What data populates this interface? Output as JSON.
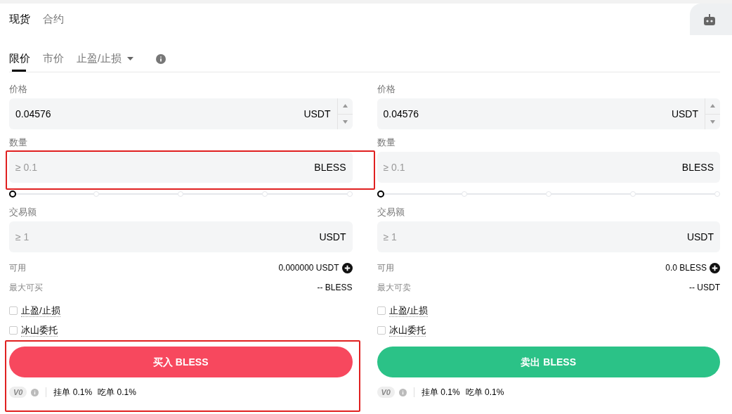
{
  "market_tabs": [
    {
      "label": "现货",
      "selected": true
    },
    {
      "label": "合约",
      "selected": false
    }
  ],
  "order_types": [
    {
      "label": "限价",
      "selected": true,
      "kind": "tab"
    },
    {
      "label": "市价",
      "selected": false,
      "kind": "tab"
    },
    {
      "label": "止盈/止损",
      "selected": false,
      "kind": "dropdown"
    }
  ],
  "panels": [
    {
      "kind": "buy",
      "rows": [
        {
          "kind": "field",
          "label": "价格",
          "value": "0.04576",
          "unit": "USDT",
          "stepper": true
        },
        {
          "kind": "field",
          "label": "数量",
          "placeholder": "≥ 0.1",
          "unit": "BLESS",
          "stepper": false
        },
        {
          "kind": "slider",
          "level": 0
        },
        {
          "kind": "field",
          "label": "交易额",
          "placeholder": "≥ 1",
          "unit": "USDT",
          "stepper": false
        }
      ],
      "available": {
        "label": "可用",
        "value": "0.000000 USDT"
      },
      "max": {
        "label": "最大可买",
        "value": "-- BLESS"
      },
      "checkboxes": [
        {
          "label": "止盈/止损",
          "checked": false
        },
        {
          "label": "冰山委托",
          "checked": false
        }
      ],
      "button": "买入 BLESS",
      "tier": "V0",
      "maker": "挂单 0.1%",
      "taker": "吃单 0.1%"
    },
    {
      "kind": "sell",
      "rows": [
        {
          "kind": "field",
          "label": "价格",
          "value": "0.04576",
          "unit": "USDT",
          "stepper": true
        },
        {
          "kind": "field",
          "label": "数量",
          "placeholder": "≥ 0.1",
          "unit": "BLESS",
          "stepper": false
        },
        {
          "kind": "slider",
          "level": 0
        },
        {
          "kind": "field",
          "label": "交易额",
          "placeholder": "≥ 1",
          "unit": "USDT",
          "stepper": false
        }
      ],
      "available": {
        "label": "可用",
        "value": "0.0 BLESS"
      },
      "max": {
        "label": "最大可卖",
        "value": "-- USDT"
      },
      "checkboxes": [
        {
          "label": "止盈/止损",
          "checked": false
        },
        {
          "label": "冰山委托",
          "checked": false
        }
      ],
      "button": "卖出 BLESS",
      "tier": "V0",
      "maker": "挂单 0.1%",
      "taker": "吃单 0.1%"
    }
  ]
}
